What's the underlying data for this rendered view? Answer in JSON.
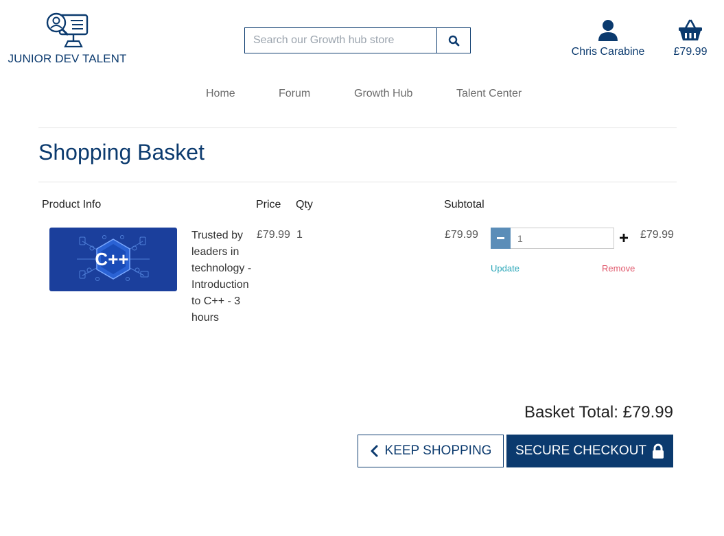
{
  "brand": {
    "name": "JUNIOR DEV TALENT"
  },
  "search": {
    "placeholder": "Search our Growth hub store",
    "value": ""
  },
  "account": {
    "name": "Chris Carabine"
  },
  "header_basket": {
    "total": "£79.99"
  },
  "nav": {
    "items": [
      "Home",
      "Forum",
      "Growth Hub",
      "Talent Center"
    ]
  },
  "page": {
    "title": "Shopping Basket"
  },
  "table": {
    "headers": {
      "product_info": "Product Info",
      "price": "Price",
      "qty": "Qty",
      "subtotal": "Subtotal"
    },
    "rows": [
      {
        "name": "Trusted by leaders in technology - Introduction to C++ - 3 hours",
        "price": "£79.99",
        "qty": "1",
        "subtotal": "£79.99",
        "quantity_input": "1",
        "line_total": "£79.99",
        "update_label": "Update",
        "remove_label": "Remove",
        "image_glyph": "C++"
      }
    ]
  },
  "summary": {
    "total_label": "Basket Total: £79.99"
  },
  "actions": {
    "keep_shopping": "KEEP SHOPPING",
    "checkout": "SECURE CHECKOUT"
  },
  "colors": {
    "primary": "#0b3a6e",
    "stepper": "#5b8db8",
    "update": "#2aa6b8",
    "remove": "#e0566a",
    "product_bg": "#1b3f9c"
  },
  "icons": {
    "logo": "person-magnifier-monitor-icon",
    "search": "search-icon",
    "user": "user-icon",
    "basket": "basket-icon",
    "minus": "minus-icon",
    "plus": "plus-icon",
    "back": "chevron-left-icon",
    "lock": "lock-icon"
  }
}
